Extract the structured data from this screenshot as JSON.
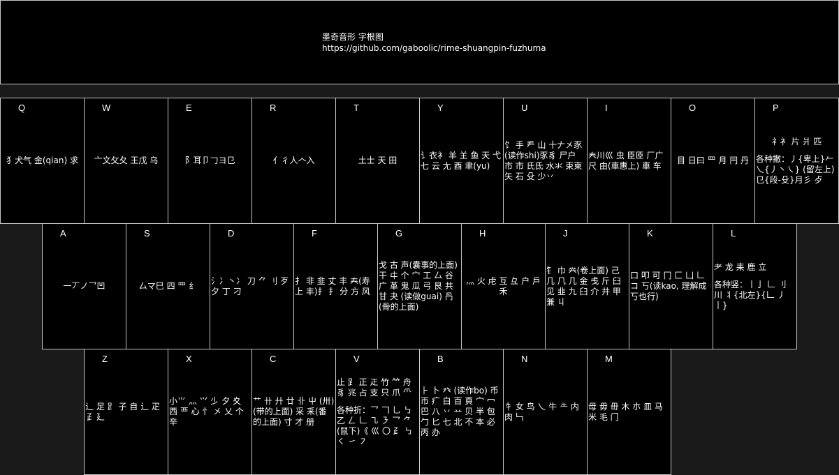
{
  "header": {
    "title": "墨奇音形 字根图",
    "url": "https://github.com/gaboolic/rime-shuangpin-fuzhuma"
  },
  "rows": [
    [
      {
        "letter": "Q",
        "roots": "犭犬气 金(qian) 求",
        "extra": ""
      },
      {
        "letter": "W",
        "roots": "亠文攵夂 王戊 乌",
        "extra": ""
      },
      {
        "letter": "E",
        "roots": "阝耳卩𠃌ヨ㔾",
        "extra": ""
      },
      {
        "letter": "R",
        "roots": "亻彳人𠆢入",
        "extra": ""
      },
      {
        "letter": "T",
        "roots": "土士 天 田",
        "extra": ""
      },
      {
        "letter": "Y",
        "roots": "讠衣衤 羊 𦍌 鱼 天 弋 七 云 尢 酉 聿(yu)",
        "extra": ""
      },
      {
        "letter": "U",
        "roots": "饣 手 龵 山 十𠂇㐅豕(读作shi)豕豸 尸户 市 市 氏氐 水氺 束柬 矢 石 殳 少丷",
        "extra": ""
      },
      {
        "letter": "I",
        "roots": "𡗗川巛 虫 臣𦣞 厂广 尺 甶(車惠上) 車 车",
        "extra": ""
      },
      {
        "letter": "O",
        "roots": "目 日曰 罒 月 冃 丹",
        "extra": ""
      },
      {
        "letter": "P",
        "roots": "礻衤 片 爿 匹",
        "extra": "各种撇：丿{卑上}𠂉乀{丿丶㇏} (留左上) 㔾{段-殳}月彡 歺"
      }
    ],
    [
      {
        "letter": "A",
        "roots": "一丆ノ乛凹",
        "extra": ""
      },
      {
        "letter": "S",
        "roots": "厶マ巳 四 罒 纟",
        "extra": ""
      },
      {
        "letter": "D",
        "roots": "氵冫丶冫 刀 ⺈ 刂 歹 夕 丁 刁",
        "extra": ""
      },
      {
        "letter": "F",
        "roots": "扌 非 韭 丈 丰 𡗗(寿上 丰)⺘ 扌 分 方 风",
        "extra": ""
      },
      {
        "letter": "G",
        "roots": "戈 古 声(囊事的上面) 干 㐄 个 宀 工 厶 谷 广 革 鬼 瓜 弓 艮 共 甘 夬 (读做guai) 冎(骨的上面)",
        "extra": ""
      },
      {
        "letter": "H",
        "roots": "灬 火 虍 互 彑 户 戶 禾",
        "extra": ""
      },
      {
        "letter": "J",
        "roots": "钅 巾 𠔉(卷上面) 己 几 𠘨 几 金 戋 斤 臼 见 韭 九 臼 介 井 甲 兼 丩",
        "extra": ""
      },
      {
        "letter": "K",
        "roots": "口 叩 可 冂 匚 凵 𠃊 コ 丂(读kao, 理解成丂也行)",
        "extra": ""
      },
      {
        "letter": "L",
        "roots": "耂 龙 耒 鹿 立",
        "extra": "各种竖：丨亅 𠃊 刂 川 丬{北左}{𠃊 丿 丨}"
      }
    ],
    [
      {
        "letter": "Z",
        "roots": "辶 足 𧾷 子 自 辶 疋 𤴔 廴",
        "extra": ""
      },
      {
        "letter": "X",
        "roots": "小⺌ 灬 ⺍ 𣥂 夕 夊 西 覀 心 忄 㐅 乂 个 辛",
        "extra": ""
      },
      {
        "letter": "C",
        "roots": "艹 卄 廾 廿 卝 屮 (卅)(带的上面) 采 釆(番的上面) 寸 才 册",
        "extra": ""
      },
      {
        "letter": "V",
        "roots": "止 𧾷 正 𤴓 竹 ⺮ 舟 豸 兆 占 支 只 爪 ⺥",
        "extra": "各种折：乛 𠃍 乚 ㇉ 乙 𠃋 𠃊 ㇈ ㇋ 乛 ⺈ (鼠下)《 巛 〇 ⺪ ㇉ ㇛ ㇀ ㇇"
      },
      {
        "letter": "B",
        "roots": "⺊ 卜 癶 (读作bo) 币 帀 疒 白 百 頁 宀 冖 巴 八 丷 䒑 贝 半 包 勹 匕 七 北 不 本 必 丙 办",
        "extra": ""
      },
      {
        "letter": "N",
        "roots": "牜 女 鸟 乀 牛 𠂒 内 肉 𠃑",
        "extra": ""
      },
      {
        "letter": "M",
        "roots": "母 毋 毌 木 朩 皿 马 米 毛 门",
        "extra": ""
      }
    ]
  ]
}
